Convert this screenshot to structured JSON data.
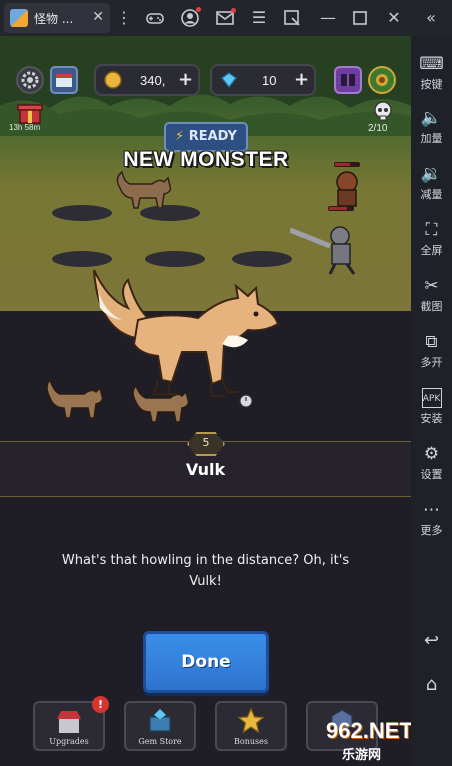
{
  "window": {
    "tab_title": "怪物 ...",
    "icons": [
      "more-icon",
      "gamepad-icon",
      "account-icon",
      "mail-icon",
      "menu-icon",
      "screenshot-icon",
      "minimize-icon",
      "maximize-icon",
      "close-icon",
      "collapse-icon"
    ]
  },
  "sidebar": {
    "items": [
      {
        "label": "按键",
        "icon": "keyboard-icon"
      },
      {
        "label": "加量",
        "icon": "volume-up-icon"
      },
      {
        "label": "减量",
        "icon": "volume-down-icon"
      },
      {
        "label": "全屏",
        "icon": "fullscreen-icon"
      },
      {
        "label": "截图",
        "icon": "scissors-icon"
      },
      {
        "label": "多开",
        "icon": "multi-instance-icon"
      },
      {
        "label": "安装",
        "icon": "apk-install-icon"
      },
      {
        "label": "设置",
        "icon": "settings-icon"
      },
      {
        "label": "更多",
        "icon": "more-icon"
      }
    ]
  },
  "hud": {
    "coins": "340,",
    "gems": "10",
    "timer": "13h 58m",
    "monster_count": "2/10",
    "ready_label": "READY"
  },
  "banner": {
    "title": "NEW MONSTER"
  },
  "monster": {
    "level": "5",
    "name": "Vulk",
    "description": "What's that howling in the distance? Oh, it's Vulk!"
  },
  "actions": {
    "done_label": "Done"
  },
  "bottom_bar": {
    "items": [
      {
        "label": "Upgrades",
        "badge": "!"
      },
      {
        "label": "Gem Store"
      },
      {
        "label": "Bonuses"
      }
    ]
  },
  "watermark": {
    "text": "962.NET",
    "sub": "乐游网"
  },
  "colors": {
    "accent_blue": "#3a8ee8",
    "notif_red": "#d8332d",
    "gold": "#b59a52"
  }
}
